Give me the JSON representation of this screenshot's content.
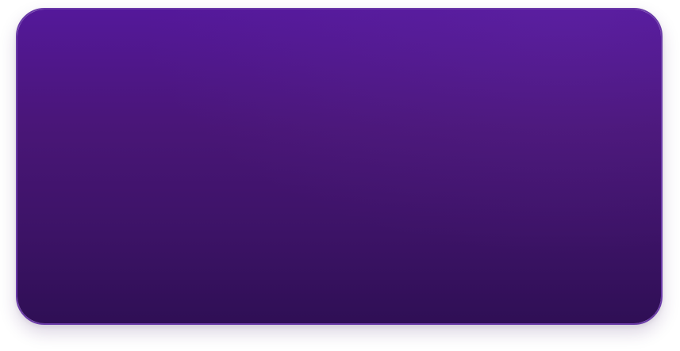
{
  "card": {
    "colors": {
      "top": "#54189a",
      "bottom": "#2f0f55",
      "border": "#6a3aa8"
    }
  }
}
